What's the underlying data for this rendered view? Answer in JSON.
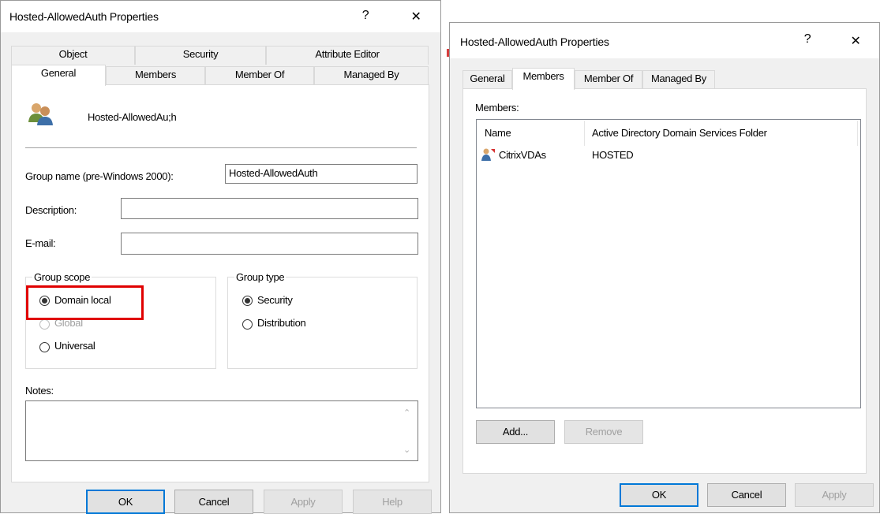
{
  "left_dialog": {
    "title": "Hosted-AllowedAuth Properties",
    "help_glyph": "?",
    "close_glyph": "✕",
    "tabs_row1": [
      "Object",
      "Security",
      "Attribute Editor"
    ],
    "tabs_row2": [
      "General",
      "Members",
      "Member Of",
      "Managed By"
    ],
    "group_display_name": "Hosted-AllowedAu;h",
    "group_icon": "users-group-icon",
    "fields": {
      "group_name_label": "Group name (pre-Windows 2000):",
      "group_name_value": "Hosted-AllowedAuth",
      "description_label": "Description:",
      "description_value": "",
      "email_label": "E-mail:",
      "email_value": ""
    },
    "group_scope": {
      "label": "Group scope",
      "options": [
        "Domain local",
        "Global",
        "Universal"
      ],
      "selected": "Domain local"
    },
    "group_type": {
      "label": "Group type",
      "options": [
        "Security",
        "Distribution"
      ],
      "selected": "Security"
    },
    "notes_label": "Notes:",
    "notes_value": "",
    "buttons": {
      "ok": "OK",
      "cancel": "Cancel",
      "apply": "Apply",
      "help": "Help"
    },
    "highlight_color": "#e00000"
  },
  "right_dialog": {
    "title": "Hosted-AllowedAuth Properties",
    "help_glyph": "?",
    "close_glyph": "✕",
    "tabs": [
      "General",
      "Members",
      "Member Of",
      "Managed By"
    ],
    "members_label": "Members:",
    "columns": [
      "Name",
      "Active Directory Domain Services Folder"
    ],
    "rows": [
      {
        "name": "CitrixVDAs",
        "folder": "HOSTED",
        "icon": "group-member-icon"
      }
    ],
    "buttons": {
      "add": "Add...",
      "remove": "Remove",
      "ok": "OK",
      "cancel": "Cancel",
      "apply": "Apply"
    }
  },
  "accent_color": "#0078d7"
}
